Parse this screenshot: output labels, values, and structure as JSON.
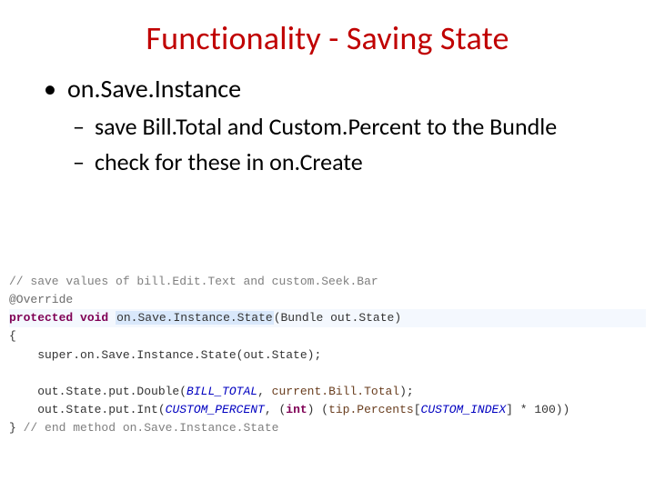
{
  "title": "Functionality - Saving State",
  "bullet1": "on.Save.Instance",
  "sub1": "save Bill.Total and Custom.Percent to the Bundle",
  "sub2": "check for these in on.Create",
  "code": {
    "c1": "// save values of bill.Edit.Text and custom.Seek.Bar",
    "ann": "@Override",
    "kw_prot": "protected",
    "kw_void": "void",
    "method": "on.Save.Instance.State",
    "sig_tail": "(Bundle out.State)",
    "brace_open": "{",
    "l_super": "    super.on.Save.Instance.State(out.State);",
    "l_put1a": "    out.State.put.Double(",
    "f_bill": "BILL_TOTAL",
    "l_put1b": ", ",
    "v_cbt": "current.Bill.Total",
    "l_put1c": ");",
    "l_put2a": "    out.State.put.Int(",
    "f_cust": "CUSTOM_PERCENT",
    "l_put2b": ", (",
    "kw_int": "int",
    "l_put2c": ") (",
    "v_tp": "tip.Percents",
    "l_put2d": "[",
    "f_ci": "CUSTOM_INDEX",
    "l_put2e": "] * 100))",
    "brace_close": "}",
    "c2": " // end method on.Save.Instance.State"
  }
}
